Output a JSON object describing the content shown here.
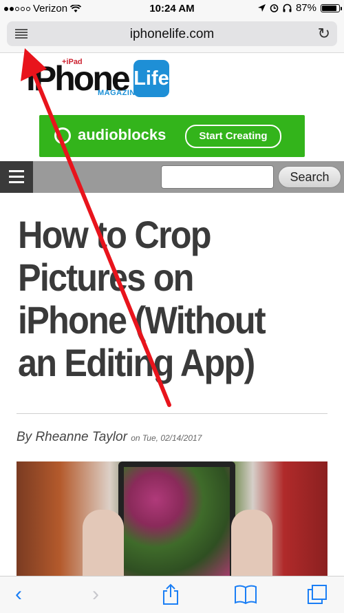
{
  "status_bar": {
    "carrier": "Verizon",
    "time": "10:24 AM",
    "battery_percent": "87%",
    "battery_level": 0.87,
    "signal_bars_filled": 2,
    "signal_bars_total": 5,
    "icons": [
      "wifi-icon",
      "location-icon",
      "alarm-icon",
      "headphones-icon",
      "battery-icon"
    ]
  },
  "url_bar": {
    "url": "iphonelife.com",
    "left_icon": "reader-view-icon",
    "right_icon": "reload-icon"
  },
  "logo": {
    "brand": "iPhone",
    "subbrand": "+iPad",
    "magazine": "MAGAZINE",
    "life": "Life"
  },
  "ad": {
    "name": "audioblocks",
    "cta": "Start Creating",
    "color": "#33b41b"
  },
  "nav": {
    "search_placeholder": "",
    "search_button": "Search"
  },
  "article": {
    "title": "How to Crop Pictures on iPhone (Without an Editing App)",
    "author": "By Rheanne Taylor",
    "date": "on Tue, 02/14/2017"
  },
  "toolbar": {
    "icons": [
      "back-icon",
      "forward-icon",
      "share-icon",
      "bookmarks-icon",
      "tabs-icon"
    ]
  },
  "colors": {
    "accent": "#1a7ef5",
    "annotation_arrow": "#e8141c",
    "title_text": "#3a3a3a"
  }
}
